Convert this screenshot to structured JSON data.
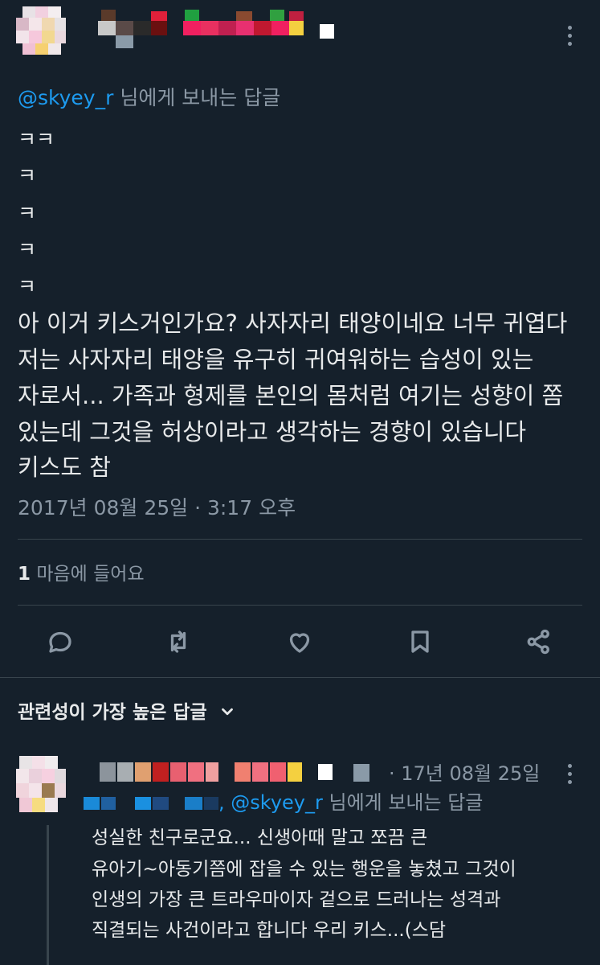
{
  "tweet": {
    "reply_to": {
      "handle": "@skyey_r",
      "suffix": " 님에게 보내는 답글"
    },
    "lines": [
      "ㅋㅋ",
      "ㅋ",
      "ㅋ",
      "ㅋ",
      "ㅋ",
      "아 이거 키스거인가요? 사자자리 태양이네요 너무 귀엽다",
      "저는 사자자리 태양을 유구히 귀여워하는 습성이 있는",
      "자로서... 가족과 형제를 본인의 몸처럼 여기는 성향이 쫌",
      "있는데 그것을 허상이라고 생각하는 경향이 있습니다",
      "키스도 참"
    ],
    "timestamp": "2017년 08월 25일 · 3:17 오후",
    "likes": {
      "count": "1",
      "label": " 마음에 들어요"
    },
    "actions": [
      "reply-icon",
      "retweet-icon",
      "like-icon",
      "bookmark-icon",
      "share-icon"
    ]
  },
  "replies_header": {
    "label": "관련성이 가장 높은 답글"
  },
  "reply": {
    "date": "· 17년 08월 25일",
    "mention": {
      "handle": "@skyey_r",
      "prefix": ", ",
      "suffix": " 님에게 보내는 답글"
    },
    "lines": [
      "성실한 친구로군요... 신생아때 말고 쪼끔 큰",
      "유아기~아동기쯤에 잡을 수 있는 행운을 놓쳤고 그것이",
      "인생의 가장 큰 트라우마이자 겉으로 드러나는 성격과",
      "직결되는 사건이라고 합니다 우리 키스...(스담"
    ]
  },
  "colors": {
    "background": "#15202b",
    "text": "#e7e9ea",
    "muted": "#8b98a5",
    "accent": "#1d9bf0",
    "divider": "#38444d"
  }
}
